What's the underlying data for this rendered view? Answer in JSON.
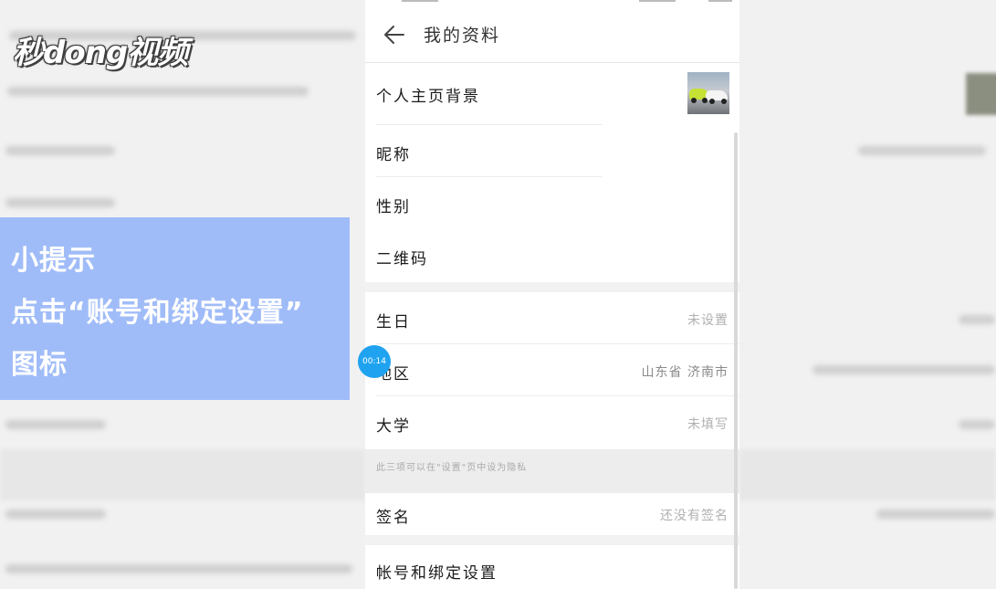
{
  "watermark": {
    "logo_text": "秒dong视频"
  },
  "tip": {
    "line1": "小提示",
    "line2": "点击“账号和绑定设置”",
    "line3": "图标"
  },
  "header": {
    "title": "我的资料",
    "back_icon": "arrow-left-icon"
  },
  "rows": {
    "background": {
      "label": "个人主页背景"
    },
    "nickname": {
      "label": "昵称"
    },
    "gender": {
      "label": "性别"
    },
    "qrcode": {
      "label": "二维码"
    },
    "birthday": {
      "label": "生日",
      "value": "未设置"
    },
    "region": {
      "label": "地区",
      "value": "山东省 济南市"
    },
    "university": {
      "label": "大学",
      "value": "未填写"
    },
    "signature": {
      "label": "签名",
      "value": "还没有签名"
    },
    "account": {
      "label": "帐号和绑定设置"
    }
  },
  "privacy_hint": "此三项可以在\"设置\"页中设为隐私",
  "video_timer": "00:14",
  "colors": {
    "timer": "#1fa3f0",
    "tip_overlay": "#84aafa"
  }
}
